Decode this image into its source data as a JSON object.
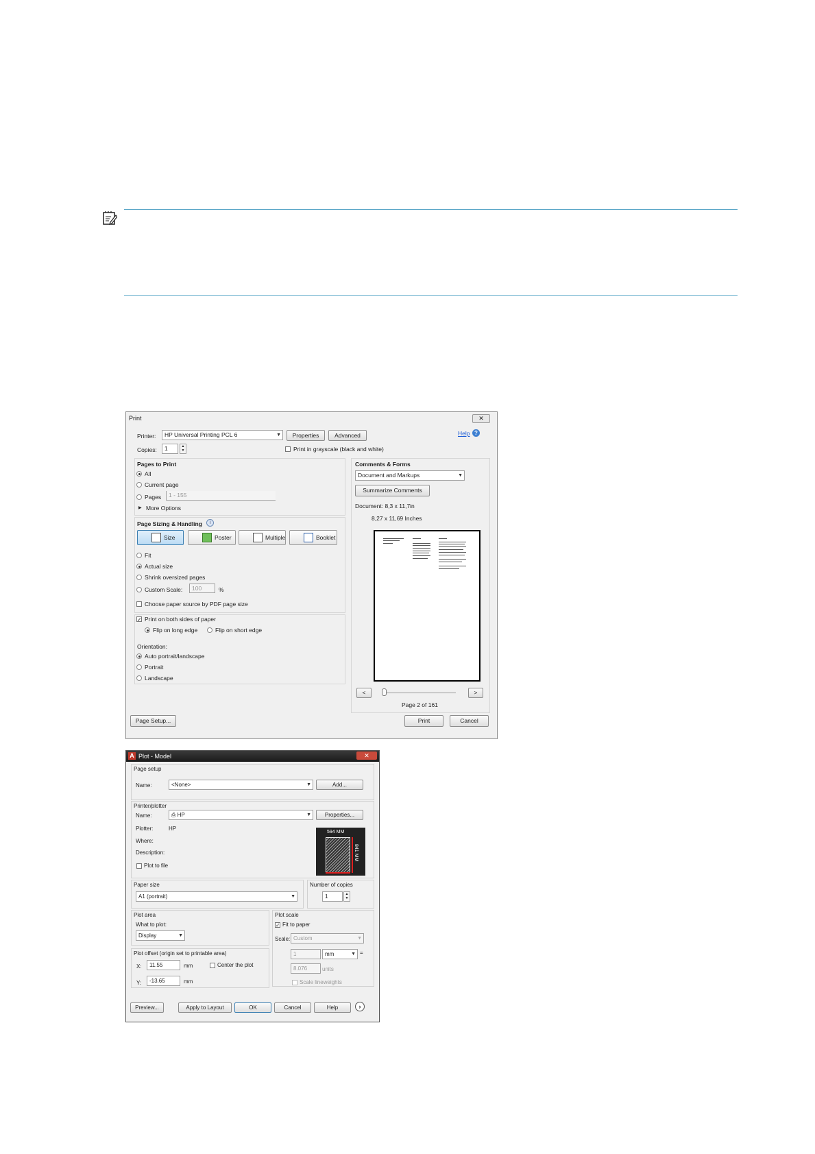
{
  "print_dialog": {
    "title": "Print",
    "close": "✕",
    "printer_label": "Printer:",
    "printer_value": "HP Universal Printing PCL 6",
    "properties_btn": "Properties",
    "advanced_btn": "Advanced",
    "help_link": "Help",
    "copies_label": "Copies:",
    "copies_value": "1",
    "grayscale_label": "Print in grayscale (black and white)",
    "pages_to_print": {
      "heading": "Pages to Print",
      "all": "All",
      "current": "Current page",
      "pages": "Pages",
      "pages_value": "1 - 155",
      "more_options": "More Options"
    },
    "sizing": {
      "heading": "Page Sizing & Handling",
      "tabs": [
        "Size",
        "Poster",
        "Multiple",
        "Booklet"
      ],
      "fit": "Fit",
      "actual": "Actual size",
      "shrink": "Shrink oversized pages",
      "custom": "Custom Scale:",
      "custom_value": "100",
      "percent": "%",
      "paper_source": "Choose paper source by PDF page size"
    },
    "duplex": {
      "both_sides": "Print on both sides of paper",
      "long_edge": "Flip on long edge",
      "short_edge": "Flip on short edge"
    },
    "orientation": {
      "heading": "Orientation:",
      "auto": "Auto portrait/landscape",
      "portrait": "Portrait",
      "landscape": "Landscape"
    },
    "comments": {
      "heading": "Comments & Forms",
      "value": "Document and Markups",
      "summarize_btn": "Summarize Comments",
      "document_size": "Document: 8,3 x 11,7in",
      "paper_size": "8,27 x 11,69 Inches",
      "prev_btn": "<",
      "next_btn": ">",
      "page_indicator": "Page 2 of 161"
    },
    "page_setup_btn": "Page Setup...",
    "print_btn": "Print",
    "cancel_btn": "Cancel"
  },
  "plot_dialog": {
    "title": "Plot - Model",
    "close": "✕",
    "page_setup": {
      "heading": "Page setup",
      "name_label": "Name:",
      "name_value": "<None>",
      "add_btn": "Add..."
    },
    "printer": {
      "heading": "Printer/plotter",
      "name_label": "Name:",
      "name_value": "HP",
      "properties_btn": "Properties...",
      "plotter_label": "Plotter:",
      "plotter_value": "HP",
      "where_label": "Where:",
      "description_label": "Description:",
      "plot_to_file": "Plot to file",
      "preview_width": "594 MM",
      "preview_height": "841 MM"
    },
    "paper_size": {
      "heading": "Paper size",
      "value": "A1 (portrait)"
    },
    "copies": {
      "heading": "Number of copies",
      "value": "1"
    },
    "plot_area": {
      "heading": "Plot area",
      "what_label": "What to plot:",
      "what_value": "Display"
    },
    "plot_scale": {
      "heading": "Plot scale",
      "fit_to_paper": "Fit to paper",
      "scale_label": "Scale:",
      "scale_value": "Custom",
      "value1": "1",
      "unit1": "mm",
      "equals": "=",
      "value2": "8.076",
      "unit2": "units",
      "lineweights": "Scale lineweights"
    },
    "offset": {
      "heading": "Plot offset (origin set to printable area)",
      "x_label": "X:",
      "x_value": "11.55",
      "x_unit": "mm",
      "center": "Center the plot",
      "y_label": "Y:",
      "y_value": "-13.65",
      "y_unit": "mm"
    },
    "buttons": {
      "preview": "Preview...",
      "apply": "Apply to Layout",
      "ok": "OK",
      "cancel": "Cancel",
      "help": "Help"
    }
  }
}
